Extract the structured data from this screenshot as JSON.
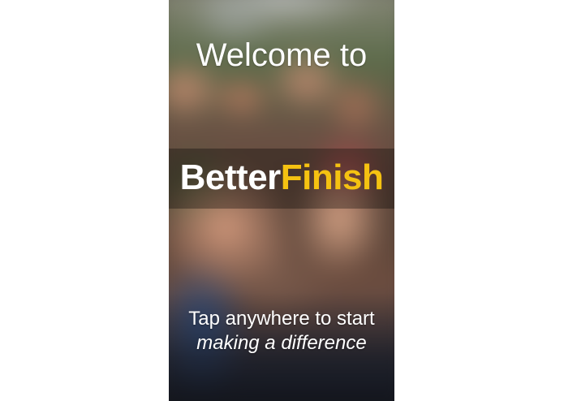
{
  "splash": {
    "welcome_text": "Welcome to",
    "brand": {
      "part1": "Better",
      "part2": "Finish",
      "part1_color": "#ffffff",
      "part2_color": "#f5c211"
    },
    "tagline": {
      "line1": "Tap anywhere to start",
      "line2": "making a difference"
    },
    "background_image": "blurred-crowd-photo"
  }
}
